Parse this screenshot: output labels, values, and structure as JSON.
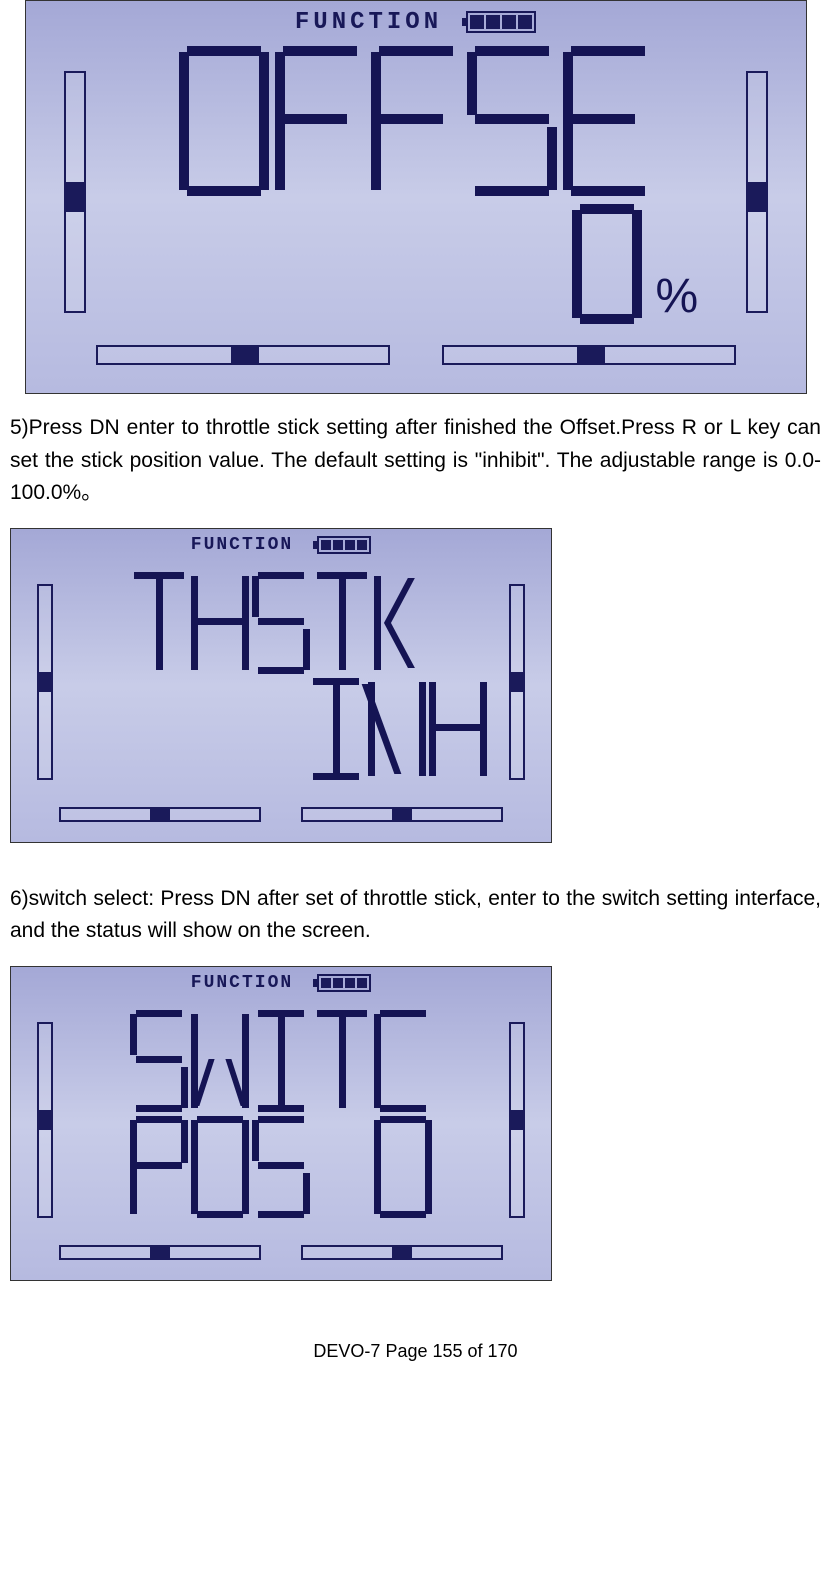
{
  "lcd1": {
    "header": "FUNCTION",
    "line1": "OFFSE",
    "value": "0",
    "unit": "%"
  },
  "para5": "5)Press DN enter to throttle stick setting after finished the Offset.Press R or L key can set the stick position value. The default setting is \"inhibit\". The adjustable range is 0.0-100.0%。",
  "lcd2": {
    "header": "FUNCTION",
    "line1": "THSTK",
    "line2": "INH"
  },
  "para6": "6)switch select: Press DN after set of throttle stick, enter to the switch setting interface, and the status will show on the screen.",
  "lcd3": {
    "header": "FUNCTION",
    "line1": "SWITC",
    "line2": "POS 0"
  },
  "footer": "DEVO-7      Page 155 of 170"
}
